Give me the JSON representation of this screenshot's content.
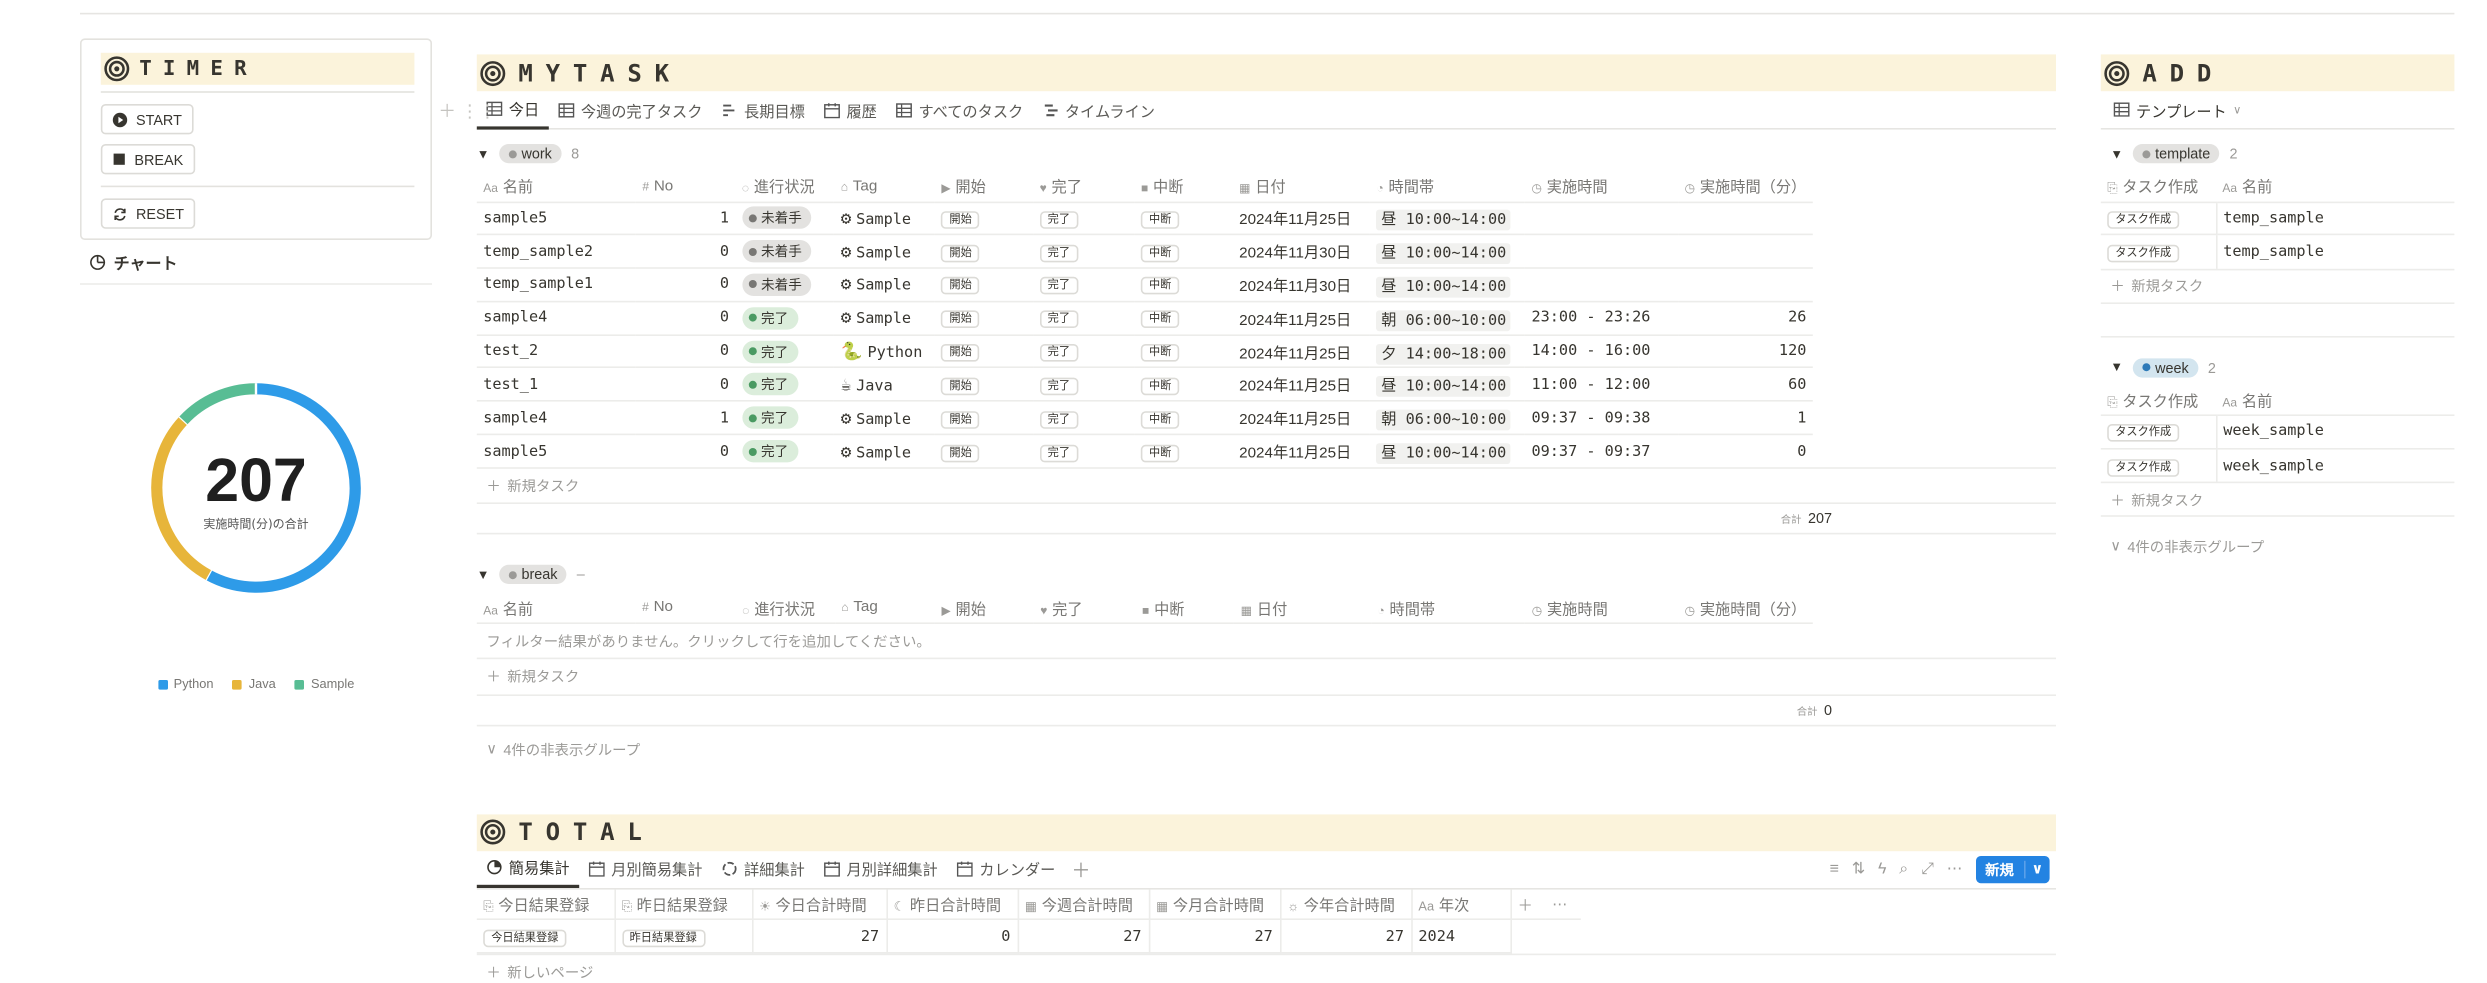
{
  "timer": {
    "title": "TIMER",
    "start_label": "START",
    "break_label": "BREAK",
    "reset_label": "RESET"
  },
  "chart_section": {
    "title": "チャート"
  },
  "chart_data": {
    "type": "pie",
    "categories": [
      "Python",
      "Java",
      "Sample"
    ],
    "values": [
      120,
      60,
      27
    ],
    "total": "207",
    "total_label": "実施時間(分)の合計",
    "colors": [
      "#2e9be8",
      "#e7b53a",
      "#58bd94"
    ]
  },
  "mytask": {
    "title": "MYTASK",
    "tabs": [
      "今日",
      "今週の完了タスク",
      "長期目標",
      "履歴",
      "すべてのタスク",
      "タイムライン"
    ],
    "columns": [
      "名前",
      "No",
      "進行状況",
      "Tag",
      "開始",
      "完了",
      "中断",
      "日付",
      "時間帯",
      "実施時間",
      "実施時間（分）"
    ],
    "groups": {
      "work": {
        "name": "work",
        "count": "8",
        "rows": [
          {
            "name": "sample5",
            "no": "1",
            "status": "未着手",
            "tag": "Sample",
            "start": "開始",
            "done": "完了",
            "pause": "中断",
            "date": "2024年11月25日",
            "slot": "昼 10:00~14:00",
            "time": "",
            "minutes": ""
          },
          {
            "name": "temp_sample2",
            "no": "0",
            "status": "未着手",
            "tag": "Sample",
            "start": "開始",
            "done": "完了",
            "pause": "中断",
            "date": "2024年11月30日",
            "slot": "昼 10:00~14:00",
            "time": "",
            "minutes": ""
          },
          {
            "name": "temp_sample1",
            "no": "0",
            "status": "未着手",
            "tag": "Sample",
            "start": "開始",
            "done": "完了",
            "pause": "中断",
            "date": "2024年11月30日",
            "slot": "昼 10:00~14:00",
            "time": "",
            "minutes": ""
          },
          {
            "name": "sample4",
            "no": "0",
            "status": "完了",
            "tag": "Sample",
            "start": "開始",
            "done": "完了",
            "pause": "中断",
            "date": "2024年11月25日",
            "slot": "朝 06:00~10:00",
            "time": "23:00 - 23:26",
            "minutes": "26"
          },
          {
            "name": "test_2",
            "no": "0",
            "status": "完了",
            "tag": "Python",
            "start": "開始",
            "done": "完了",
            "pause": "中断",
            "date": "2024年11月25日",
            "slot": "夕 14:00~18:00",
            "time": "14:00 - 16:00",
            "minutes": "120"
          },
          {
            "name": "test_1",
            "no": "0",
            "status": "完了",
            "tag": "Java",
            "start": "開始",
            "done": "完了",
            "pause": "中断",
            "date": "2024年11月25日",
            "slot": "昼 10:00~14:00",
            "time": "11:00 - 12:00",
            "minutes": "60"
          },
          {
            "name": "sample4",
            "no": "1",
            "status": "完了",
            "tag": "Sample",
            "start": "開始",
            "done": "完了",
            "pause": "中断",
            "date": "2024年11月25日",
            "slot": "朝 06:00~10:00",
            "time": "09:37 - 09:38",
            "minutes": "1"
          },
          {
            "name": "sample5",
            "no": "0",
            "status": "完了",
            "tag": "Sample",
            "start": "開始",
            "done": "完了",
            "pause": "中断",
            "date": "2024年11月25日",
            "slot": "昼 10:00~14:00",
            "time": "09:37 - 09:37",
            "minutes": "0"
          }
        ],
        "new_task": "新規タスク",
        "sum_label": "合計",
        "sum_value": "207"
      },
      "break": {
        "name": "break",
        "count": "–",
        "empty_text": "フィルター結果がありません。クリックして行を追加してください。",
        "new_task": "新規タスク",
        "sum_label": "合計",
        "sum_value": "0"
      }
    },
    "hidden_groups": "4件の非表示グループ"
  },
  "total": {
    "title": "TOTAL",
    "tabs": [
      "簡易集計",
      "月別簡易集計",
      "詳細集計",
      "月別詳細集計",
      "カレンダー"
    ],
    "new_button": "新規",
    "columns": [
      "今日結果登録",
      "昨日結果登録",
      "今日合計時間",
      "昨日合計時間",
      "今週合計時間",
      "今月合計時間",
      "今年合計時間",
      "年次"
    ],
    "row": {
      "today_btn": "今日結果登録",
      "yesterday_btn": "昨日結果登録",
      "today": "27",
      "yesterday": "0",
      "week": "27",
      "month": "27",
      "year": "27",
      "nenji": "2024"
    },
    "new_page": "新しいページ"
  },
  "add": {
    "title": "ADD",
    "view_label": "テンプレート",
    "template": {
      "name": "template",
      "count": "2",
      "col1": "タスク作成",
      "col2": "名前",
      "rows": [
        {
          "btn": "タスク作成",
          "name": "temp_sample"
        },
        {
          "btn": "タスク作成",
          "name": "temp_sample"
        }
      ],
      "new_task": "新規タスク"
    },
    "week": {
      "name": "week",
      "count": "2",
      "col1": "タスク作成",
      "col2": "名前",
      "rows": [
        {
          "btn": "タスク作成",
          "name": "week_sample"
        },
        {
          "btn": "タスク作成",
          "name": "week_sample"
        }
      ],
      "new_task": "新規タスク"
    },
    "hidden_groups": "4件の非表示グループ"
  }
}
